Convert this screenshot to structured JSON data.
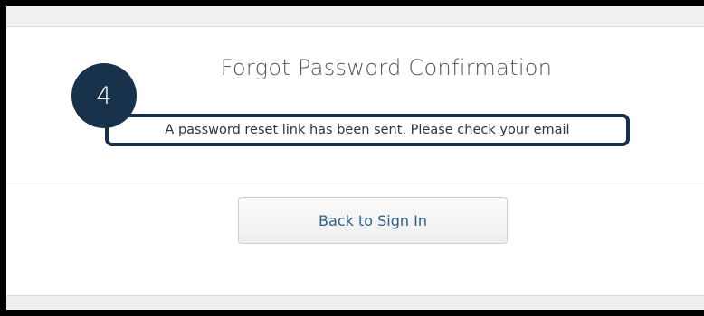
{
  "confirmation": {
    "title": "Forgot Password Confirmation",
    "message": "A password reset link has been sent. Please check your email",
    "back_button_label": "Back to Sign In"
  },
  "step_badge": {
    "number": "4"
  },
  "colors": {
    "badge_background": "#17324a",
    "highlight_border": "#15314a",
    "button_text": "#2f5f86"
  }
}
